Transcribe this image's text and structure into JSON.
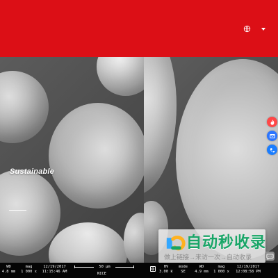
{
  "page": {
    "colors": {
      "header_red": "#dc0f16",
      "hero_gray": "#4a4a4a",
      "footer_black": "#050505",
      "watermark_green": "#18a567",
      "side_tool_colors": [
        "#ff4747",
        "#2b75ff",
        "#1a7dff"
      ]
    }
  },
  "header": {
    "language_icon": "globe-icon",
    "language_menu_icon": "chevron-down-icon"
  },
  "hero": {
    "title": "Sustainable"
  },
  "side_tools": [
    {
      "name": "fire-icon"
    },
    {
      "name": "mail-icon"
    },
    {
      "name": "contact-card-icon"
    }
  ],
  "metadata_footer": {
    "left": [
      {
        "label": "WD",
        "value": "4.8 mm"
      },
      {
        "label": "mag",
        "value": "1 000 x"
      },
      {
        "label": "12/19/2017",
        "value": "11:15:46 AM"
      }
    ],
    "scale_label": "50 µm",
    "scale_detector": "NICE",
    "right": [
      {
        "label": "HV",
        "value": "3.00 kV"
      },
      {
        "label": "mode",
        "value": "SE"
      },
      {
        "label": "WD",
        "value": "4.9 mm"
      },
      {
        "label": "mag",
        "value": "1 000 x"
      },
      {
        "label": "12/19/2017",
        "value": "12:08:58 PM"
      }
    ]
  },
  "watermark": {
    "title": "自动秒收录",
    "subtitle": "做上链接→来访一次→自动收录",
    "chat_icon": "chat-icon"
  }
}
